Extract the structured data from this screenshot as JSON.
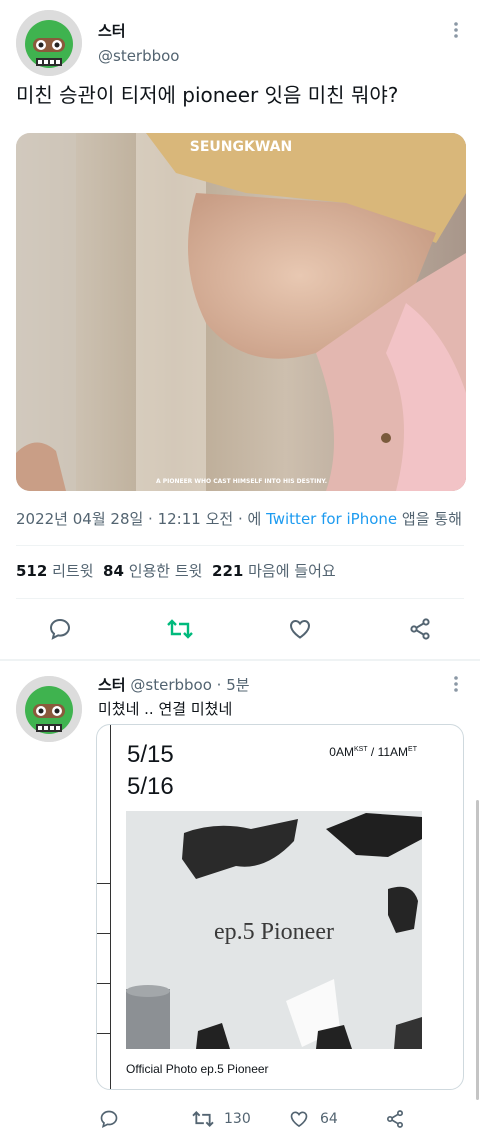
{
  "tweet": {
    "display_name": "스터",
    "handle": "@sterbboo",
    "text": "미친 승관이 티저에 pioneer 잇음 미친 뭐야?",
    "image": {
      "top_label": "SEUNGKWAN",
      "bottom_caption": "A PIONEER WHO CAST HIMSELF INTO HIS DESTINY."
    },
    "meta": {
      "date": "2022년 04월 28일 · 12:11 오전 · 에 ",
      "source": "Twitter for iPhone",
      "suffix": " 앱을 통해"
    },
    "stats": {
      "retweets": "512",
      "retweets_label": "리트윗",
      "quotes": "84",
      "quotes_label": "인용한 트윗",
      "likes": "221",
      "likes_label": "마음에 들어요"
    }
  },
  "reply": {
    "display_name": "스터",
    "handle": "@sterbboo",
    "time": "· 5분",
    "text": "미쳤네 .. 연결 미쳤네",
    "poster": {
      "date1": "5/15",
      "date2": "5/16",
      "time_a": "0AM",
      "time_a_sup": "KST",
      "time_sep": " / 11AM",
      "time_b_sup": "ET",
      "title": "ep.5 Pioneer",
      "caption": "Official Photo ep.5 Pioneer"
    },
    "actions": {
      "retweets": "130",
      "likes": "64"
    }
  },
  "colors": {
    "retweet_green": "#00ba7c",
    "icon_gray": "#536471",
    "link_blue": "#1d9bf0"
  }
}
